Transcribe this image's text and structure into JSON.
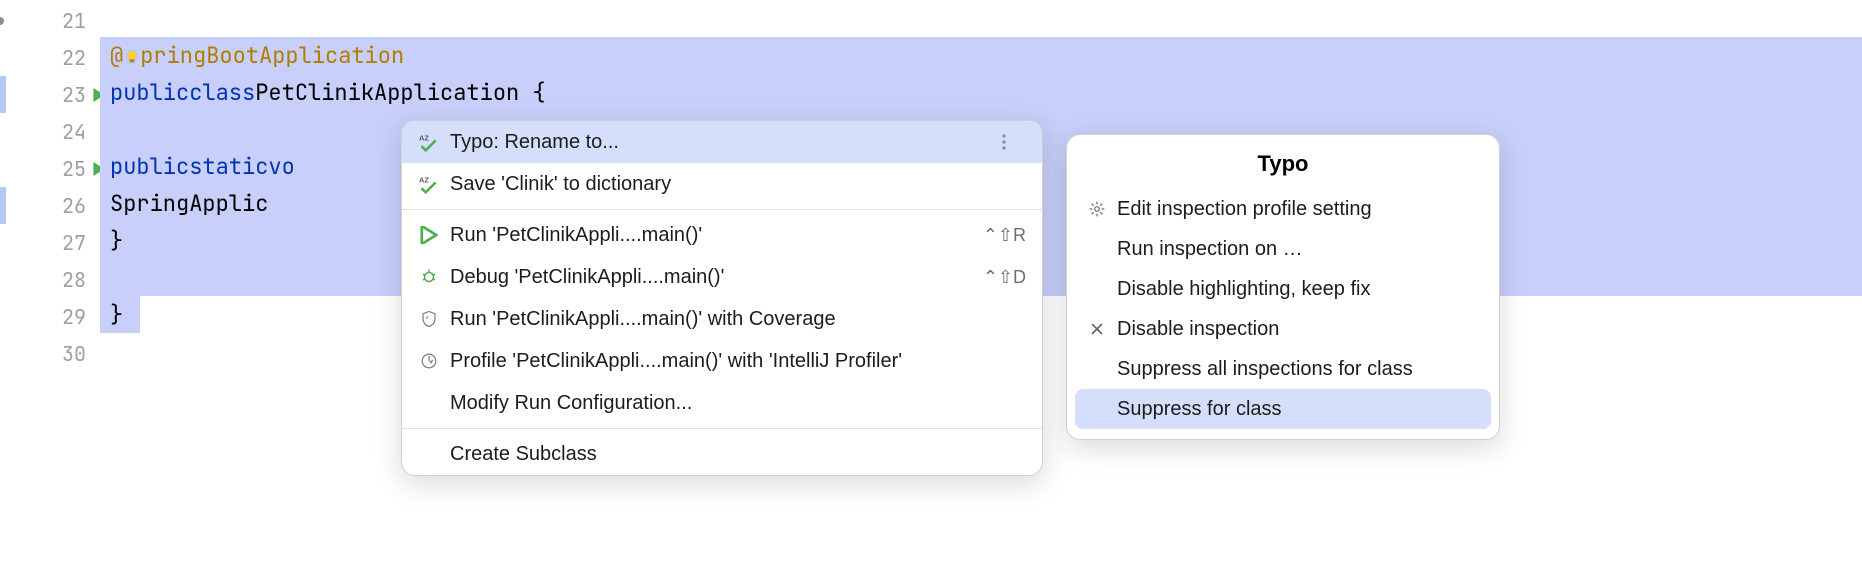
{
  "gutter": {
    "lines": [
      "21",
      "22",
      "23",
      "24",
      "25",
      "26",
      "27",
      "28",
      "29",
      "30"
    ]
  },
  "code": {
    "l22_ann_at": "@",
    "l22_ann_rest": "pringBootApplication",
    "l23_kw1": "public",
    "l23_kw2": "class",
    "l23_id": "PetClinikApplication",
    "l23_brace": " {",
    "l25_kw1": "public",
    "l25_kw2": "static",
    "l25_vo": "vo",
    "l26_txt": "SpringApplic",
    "l27_txt": "}",
    "l29_txt": "}"
  },
  "menu": {
    "items": [
      {
        "icon": "spellcheck",
        "label": "Typo: Rename to...",
        "shortcut": "",
        "selected": true,
        "more": true
      },
      {
        "icon": "spellcheck",
        "label": "Save 'Clinik' to dictionary",
        "shortcut": ""
      }
    ],
    "sep": true,
    "items2": [
      {
        "icon": "run",
        "label": "Run 'PetClinikAppli....main()'",
        "shortcut": "⌃⇧R"
      },
      {
        "icon": "debug",
        "label": "Debug 'PetClinikAppli....main()'",
        "shortcut": "⌃⇧D"
      },
      {
        "icon": "coverage",
        "label": "Run 'PetClinikAppli....main()' with Coverage",
        "shortcut": ""
      },
      {
        "icon": "profile",
        "label": "Profile 'PetClinikAppli....main()' with 'IntelliJ Profiler'",
        "shortcut": ""
      },
      {
        "icon": "",
        "label": "Modify Run Configuration...",
        "shortcut": ""
      }
    ],
    "sep2": true,
    "items3": [
      {
        "icon": "",
        "label": "Create Subclass",
        "shortcut": ""
      }
    ]
  },
  "submenu": {
    "title": "Typo",
    "items": [
      {
        "icon": "gear",
        "label": "Edit inspection profile setting",
        "selected": false
      },
      {
        "icon": "",
        "label": "Run inspection on …",
        "selected": false
      },
      {
        "icon": "",
        "label": "Disable highlighting, keep fix",
        "selected": false
      },
      {
        "icon": "close",
        "label": "Disable inspection",
        "selected": false
      },
      {
        "icon": "",
        "label": "Suppress all inspections for class",
        "selected": false
      },
      {
        "icon": "",
        "label": "Suppress for class",
        "selected": true
      }
    ]
  }
}
